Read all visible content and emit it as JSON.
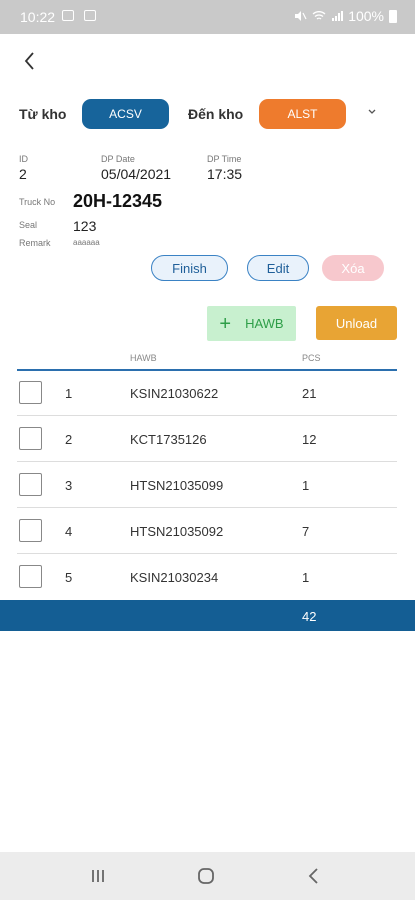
{
  "status_bar": {
    "time": "10:22",
    "battery": "100%"
  },
  "warehouse": {
    "from_label": "Từ kho",
    "from_value": "ACSV",
    "to_label": "Đến kho",
    "to_value": "ALST"
  },
  "details": {
    "id_label": "ID",
    "id_value": "2",
    "dp_date_label": "DP Date",
    "dp_date_value": "05/04/2021",
    "dp_time_label": "DP Time",
    "dp_time_value": "17:35",
    "truck_label": "Truck No",
    "truck_value": "20H-12345",
    "seal_label": "Seal",
    "seal_value": "123",
    "remark_label": "Remark",
    "remark_value": "aaaaaa"
  },
  "actions": {
    "finish": "Finish",
    "edit": "Edit",
    "delete": "Xóa",
    "add_hawb": "HAWB",
    "add_plus": "+",
    "unload": "Unload"
  },
  "table": {
    "columns": [
      "HAWB",
      "PCS"
    ],
    "rows": [
      {
        "no": "1",
        "hawb": "KSIN21030622",
        "pcs": "21"
      },
      {
        "no": "2",
        "hawb": "KCT1735126",
        "pcs": "12"
      },
      {
        "no": "3",
        "hawb": "HTSN21035099",
        "pcs": "1"
      },
      {
        "no": "4",
        "hawb": "HTSN21035092",
        "pcs": "7"
      },
      {
        "no": "5",
        "hawb": "KSIN21030234",
        "pcs": "1"
      }
    ],
    "total_pcs": "42"
  },
  "colors": {
    "primary": "#145e94",
    "from_pill": "#17649b",
    "to_pill": "#ee7b2d",
    "unload": "#e8a434",
    "add_hawb_bg": "#c8f0cf",
    "delete_bg": "#f7c8cd"
  },
  "icons": {
    "back": "chevron-left-icon",
    "dropdown": "chevron-down-icon",
    "nav_recents": "recents-icon",
    "nav_home": "home-icon",
    "nav_back": "back-icon"
  }
}
